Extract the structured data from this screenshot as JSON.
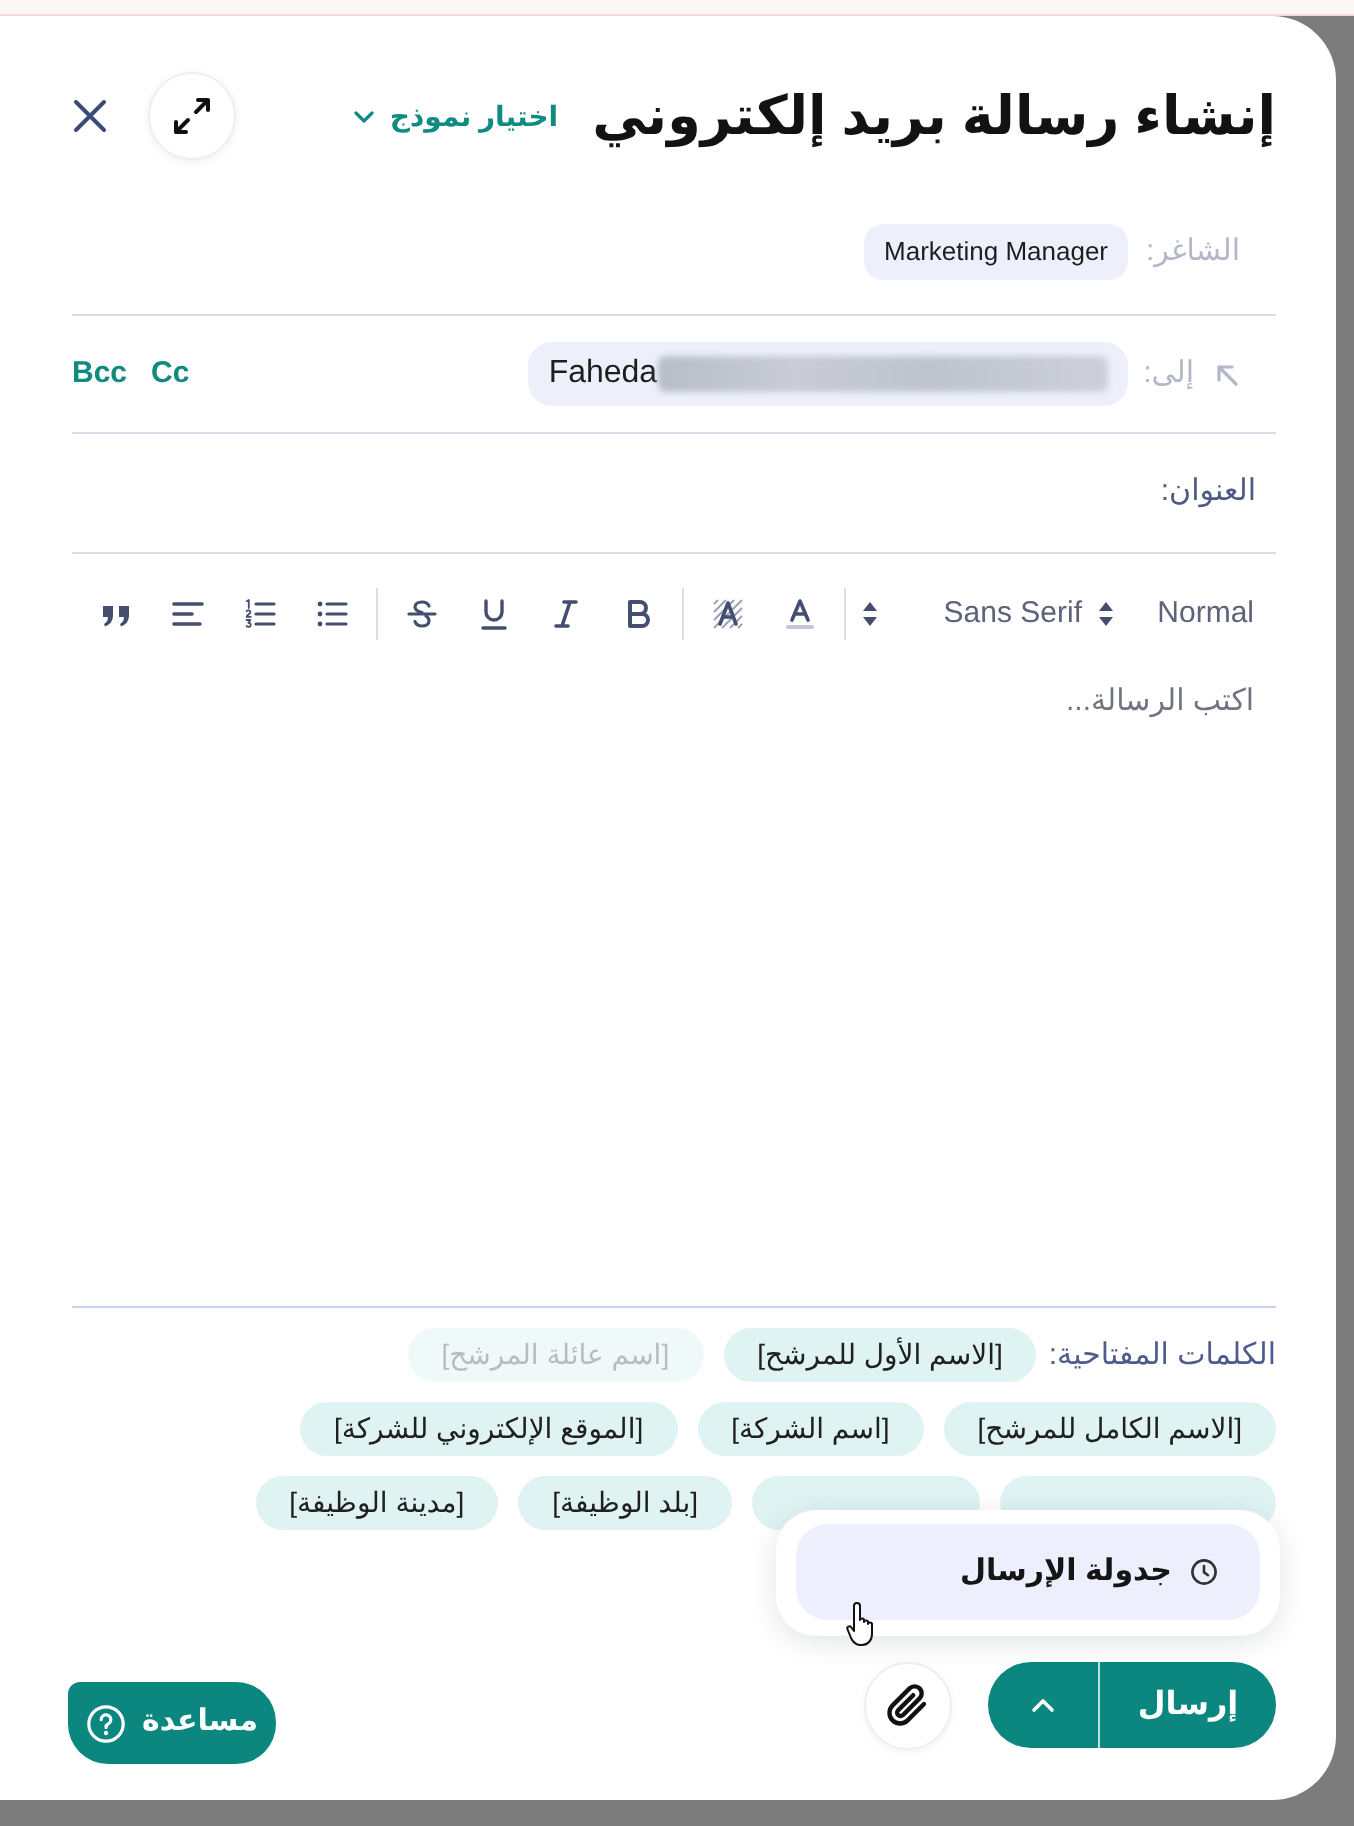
{
  "header": {
    "title": "إنشاء رسالة بريد إلكتروني",
    "template_picker": "اختيار نموذج"
  },
  "fields": [
    {
      "kind": "chip",
      "label": "الشاغر:",
      "value": "Marketing Manager"
    },
    {
      "kind": "recipient",
      "label": "إلى:",
      "value": "Faheda",
      "redacted": true,
      "options": [
        "Cc",
        "Bcc"
      ]
    },
    {
      "kind": "text",
      "label": "العنوان:"
    }
  ],
  "toolbar": {
    "pickers": [
      "Normal",
      "Sans Serif"
    ]
  },
  "editor": {
    "placeholder": "اكتب الرسالة..."
  },
  "keywords": {
    "label": "الكلمات المفتاحية:",
    "tags": [
      {
        "kind": "tag",
        "label": "[الاسم الأول للمرشح]",
        "disabled": false
      },
      {
        "kind": "tag",
        "label": "[اسم عائلة المرشح]",
        "disabled": true
      },
      {
        "kind": "tag",
        "label": "[الاسم الكامل للمرشح]",
        "disabled": false
      },
      {
        "kind": "tag",
        "label": "[اسم الشركة]",
        "disabled": false
      },
      {
        "kind": "tag",
        "label": "[الموقع الإلكتروني للشركة]",
        "disabled": false
      },
      {
        "kind": "covered",
        "disabled": false
      },
      {
        "kind": "covered",
        "disabled": false
      },
      {
        "kind": "tag",
        "label": "[بلد الوظيفة]",
        "disabled": false
      },
      {
        "kind": "tag",
        "label": "[مدينة الوظيفة]",
        "disabled": false
      }
    ]
  },
  "schedule_menu": {
    "items": [
      {
        "label": "جدولة الإرسال",
        "hovered": true
      }
    ]
  },
  "footer": {
    "send": "إرسال",
    "help": "مساعدة"
  }
}
